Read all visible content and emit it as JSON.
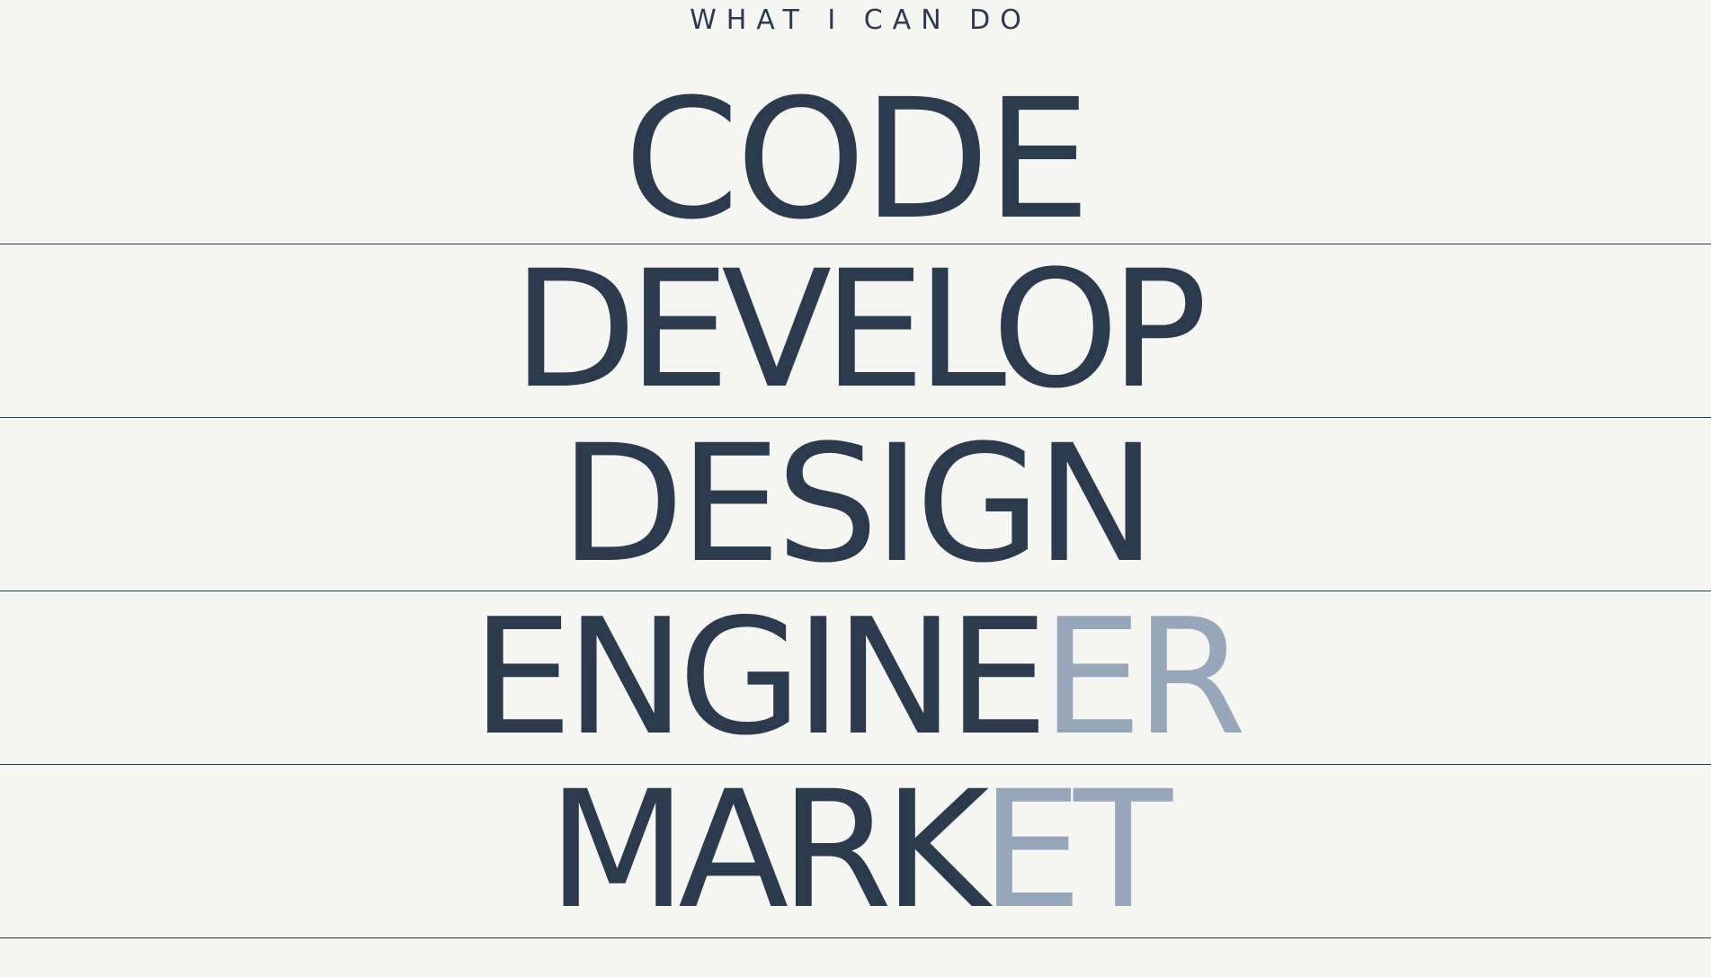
{
  "section": {
    "eyebrow": "WHAT I CAN DO"
  },
  "skills": [
    {
      "label": "CODE",
      "dark": "CODE",
      "light": ""
    },
    {
      "label": "DEVELOP",
      "dark": "DEVELOP",
      "light": ""
    },
    {
      "label": "DESIGN",
      "dark": "DESIGN",
      "light": ""
    },
    {
      "label": "ENGINEER",
      "dark": "ENGINE",
      "light": "ER"
    },
    {
      "label": "MARKET",
      "dark": "MARK",
      "light": "ET"
    }
  ],
  "colors": {
    "background": "#f5f5f3",
    "text": "#2d3a4d",
    "text_muted": "#97a6ba",
    "divider": "#2d3a4d"
  }
}
